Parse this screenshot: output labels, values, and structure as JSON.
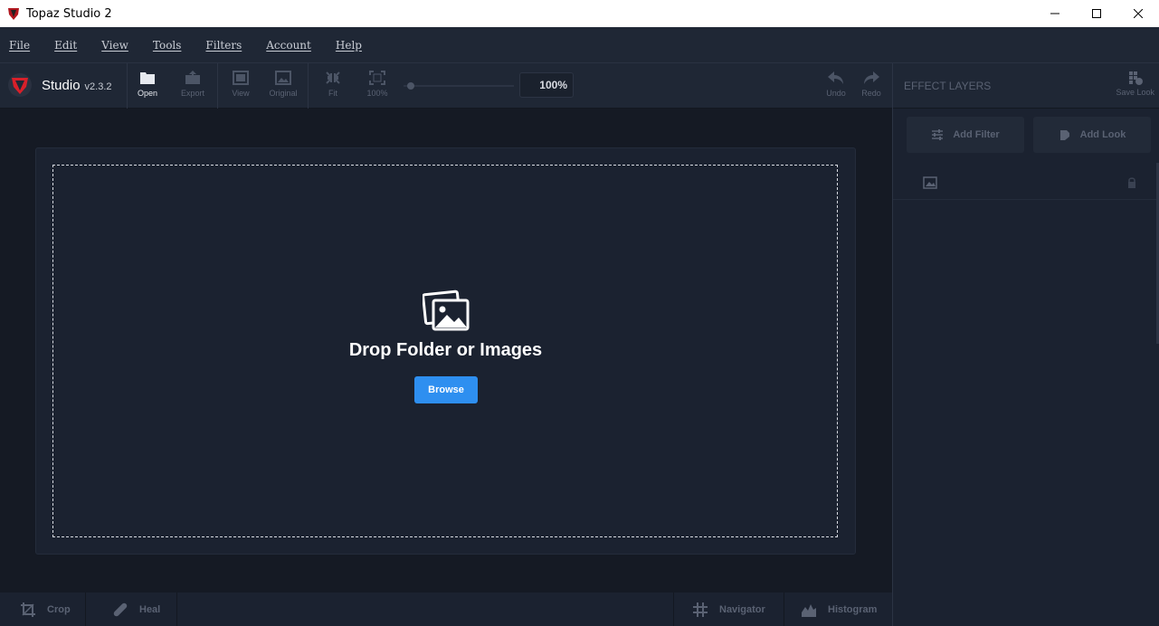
{
  "window": {
    "title": "Topaz Studio 2"
  },
  "menu": [
    "File",
    "Edit",
    "View",
    "Tools",
    "Filters",
    "Account",
    "Help"
  ],
  "brand": {
    "name": "Studio",
    "version": "v2.3.2"
  },
  "toolbar": {
    "open": "Open",
    "export": "Export",
    "view": "View",
    "original": "Original",
    "fit": "Fit",
    "full": "100%",
    "zoom_value": "100%",
    "undo": "Undo",
    "redo": "Redo"
  },
  "drop": {
    "title": "Drop Folder or Images",
    "browse": "Browse"
  },
  "bottom": {
    "crop": "Crop",
    "heal": "Heal",
    "navigator": "Navigator",
    "histogram": "Histogram"
  },
  "right_panel": {
    "title": "EFFECT LAYERS",
    "save_look": "Save Look",
    "add_filter": "Add Filter",
    "add_look": "Add Look"
  },
  "colors": {
    "accent": "#2e8ff0",
    "background": "#151a24",
    "panel": "#1f2735"
  }
}
